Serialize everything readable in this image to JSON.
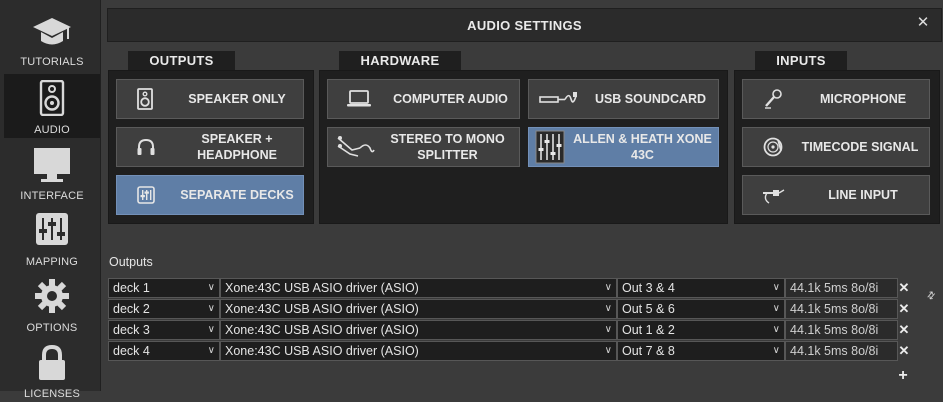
{
  "sidebar": {
    "items": [
      {
        "label": "TUTORIALS",
        "icon": "graduation-cap-icon"
      },
      {
        "label": "AUDIO",
        "icon": "speaker-icon"
      },
      {
        "label": "INTERFACE",
        "icon": "monitor-icon"
      },
      {
        "label": "MAPPING",
        "icon": "sliders-icon"
      },
      {
        "label": "OPTIONS",
        "icon": "gear-icon"
      },
      {
        "label": "LICENSES",
        "icon": "lock-icon"
      }
    ],
    "active": "AUDIO"
  },
  "dialog": {
    "title": "AUDIO SETTINGS",
    "close_icon": "close-icon"
  },
  "panels": {
    "outputs": {
      "tab": "OUTPUTS",
      "buttons": [
        {
          "label": "SPEAKER ONLY",
          "icon": "speaker-icon"
        },
        {
          "label": "SPEAKER + HEADPHONE",
          "icon": "headphones-icon"
        },
        {
          "label": "SEPARATE DECKS",
          "icon": "mixer-icon",
          "selected": true
        }
      ]
    },
    "hardware": {
      "tab": "HARDWARE",
      "buttons": [
        {
          "label": "COMPUTER AUDIO",
          "icon": "laptop-icon"
        },
        {
          "label": "USB SOUNDCARD",
          "icon": "usb-cable-icon"
        },
        {
          "label": "STEREO TO MONO SPLITTER",
          "icon": "splitter-cable-icon"
        },
        {
          "label": "ALLEN & HEATH XONE 43C",
          "icon": "dj-mixer-icon",
          "selected": true
        }
      ]
    },
    "inputs": {
      "tab": "INPUTS",
      "buttons": [
        {
          "label": "MICROPHONE",
          "icon": "microphone-icon"
        },
        {
          "label": "TIMECODE SIGNAL",
          "icon": "vinyl-icon"
        },
        {
          "label": "LINE INPUT",
          "icon": "line-cable-icon"
        }
      ]
    }
  },
  "outputs_table": {
    "label": "Outputs",
    "rows": [
      {
        "deck": "deck 1",
        "driver": "Xone:43C USB ASIO driver (ASIO)",
        "channel": "Out 3 & 4",
        "info": "44.1k 5ms 8o/8i"
      },
      {
        "deck": "deck 2",
        "driver": "Xone:43C USB ASIO driver (ASIO)",
        "channel": "Out 5 & 6",
        "info": "44.1k 5ms 8o/8i"
      },
      {
        "deck": "deck 3",
        "driver": "Xone:43C USB ASIO driver (ASIO)",
        "channel": "Out 1 & 2",
        "info": "44.1k 5ms 8o/8i"
      },
      {
        "deck": "deck 4",
        "driver": "Xone:43C USB ASIO driver (ASIO)",
        "channel": "Out 7 & 8",
        "info": "44.1k 5ms 8o/8i"
      }
    ],
    "remove_glyph": "✕",
    "add_glyph": "+",
    "swap_glyph": "⇅"
  },
  "colors": {
    "selected": "#5f7ea6",
    "panel": "#1f1f1f",
    "button": "#3f3f3f",
    "background": "#3b3b3b"
  }
}
